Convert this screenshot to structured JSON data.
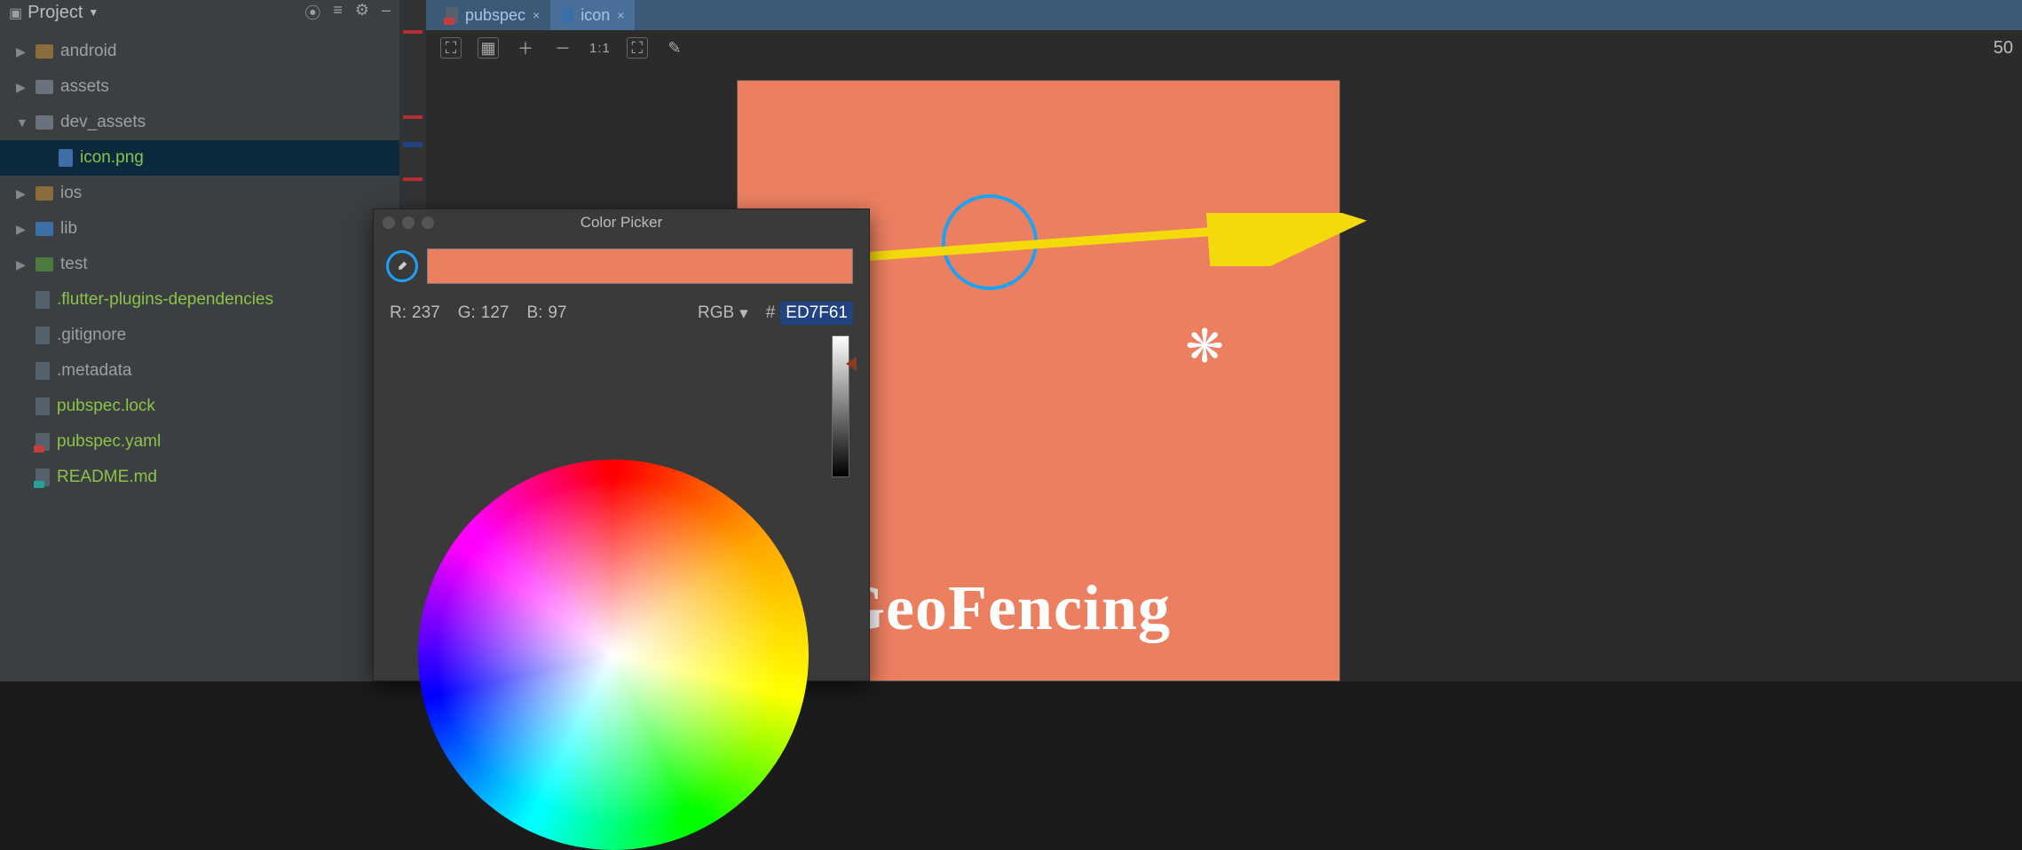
{
  "project": {
    "header_label": "Project",
    "tools": {
      "target": "⦿",
      "collapse": "≡",
      "gear": "⚙",
      "hide": "–"
    },
    "tree": [
      {
        "arrow": "▶",
        "icon": "dir brown",
        "label": "android",
        "cls": "dim",
        "depth": 0
      },
      {
        "arrow": "▶",
        "icon": "dir",
        "label": "assets",
        "cls": "dim",
        "depth": 0
      },
      {
        "arrow": "▼",
        "icon": "dir",
        "label": "dev_assets",
        "cls": "dim",
        "depth": 0
      },
      {
        "arrow": "",
        "icon": "file img",
        "label": "icon.png",
        "cls": "special",
        "depth": 1,
        "selected": true
      },
      {
        "arrow": "▶",
        "icon": "dir brown",
        "label": "ios",
        "cls": "dim",
        "depth": 0
      },
      {
        "arrow": "▶",
        "icon": "dir blue",
        "label": "lib",
        "cls": "dim",
        "depth": 0
      },
      {
        "arrow": "▶",
        "icon": "dir green",
        "label": "test",
        "cls": "dim",
        "depth": 0
      },
      {
        "arrow": "",
        "icon": "file",
        "label": ".flutter-plugins-dependencies",
        "cls": "file-green",
        "depth": 0
      },
      {
        "arrow": "",
        "icon": "file",
        "label": ".gitignore",
        "cls": "dim",
        "depth": 0
      },
      {
        "arrow": "",
        "icon": "file",
        "label": ".metadata",
        "cls": "dim",
        "depth": 0
      },
      {
        "arrow": "",
        "icon": "file",
        "label": "pubspec.lock",
        "cls": "file-green",
        "depth": 0
      },
      {
        "arrow": "",
        "icon": "file yml",
        "label": "pubspec.yaml",
        "cls": "file-green",
        "depth": 0
      },
      {
        "arrow": "",
        "icon": "file md",
        "label": "README.md",
        "cls": "file-green",
        "depth": 0
      }
    ]
  },
  "tabs": [
    {
      "icon": "yml",
      "label": "pubspec",
      "active": false
    },
    {
      "icon": "img",
      "label": "icon",
      "active": true
    }
  ],
  "imgbar": {
    "ratio": "1:1",
    "zoom_readout": "50"
  },
  "image": {
    "bg_color": "#ED7F61",
    "logo_text": "GeoFencing"
  },
  "picker": {
    "title": "Color Picker",
    "r_label": "R:",
    "g_label": "G:",
    "b_label": "B:",
    "r": "237",
    "g": "127",
    "b": "97",
    "mode": "RGB",
    "hex_prefix": "#",
    "hex": "ED7F61",
    "swatch_color": "#ED7F61"
  }
}
